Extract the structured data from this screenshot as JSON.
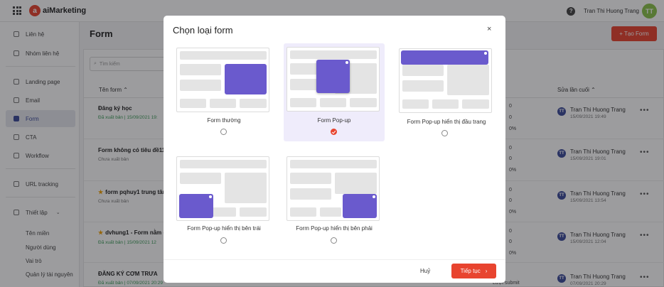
{
  "app": {
    "brand": "aiMarketing",
    "logo_letter": "a",
    "help": "?",
    "user_name": "Tran Thi Huong Trang",
    "user_initials": "TT"
  },
  "sidebar": {
    "items": [
      {
        "label": "Liên hệ"
      },
      {
        "label": "Nhóm liên hệ"
      },
      {
        "label": "Landing page"
      },
      {
        "label": "Email"
      },
      {
        "label": "Form"
      },
      {
        "label": "CTA"
      },
      {
        "label": "Workflow"
      },
      {
        "label": "URL tracking"
      },
      {
        "label": "Thiết lập"
      }
    ],
    "settings_chevron": "⌄",
    "sub_items": [
      {
        "label": "Tên miền"
      },
      {
        "label": "Người dùng"
      },
      {
        "label": "Vai trò"
      },
      {
        "label": "Quản lý tài nguyên"
      }
    ]
  },
  "main": {
    "title": "Form",
    "create_label": "+ Tạo Form",
    "search_placeholder": "Tìm kiếm",
    "columns": {
      "name": "Tên form ⌃",
      "last_edit": "Sửa lần cuối ⌃"
    },
    "rows": [
      {
        "name": "Đăng ký học",
        "status": "Đã xuất bản | 15/09/2021 19:",
        "v1": "0",
        "v2": "0",
        "v3": "0%",
        "editor": "Tran Thi Huong Trang",
        "date": "15/09/2021 19:49",
        "more": "•••"
      },
      {
        "name": "Form không có tiêu đề111",
        "status": "Chưa xuất bản",
        "v1": "0",
        "v2": "0",
        "v3": "0%",
        "editor": "Tran Thi Huong Trang",
        "date": "15/09/2021 19:01",
        "more": "•••"
      },
      {
        "name": "form pqhuy1 trung tâm",
        "status": "Chưa xuất bản",
        "v1": "0",
        "v2": "0",
        "v3": "0%",
        "editor": "Tran Thi Huong Trang",
        "date": "15/09/2021 13:54",
        "more": "•••"
      },
      {
        "name": "dvhung1 - Form nằm ở gi",
        "status": "Đã xuất bản | 15/09/2021 12",
        "v1": "0",
        "v2": "0",
        "v3": "0%",
        "editor": "Tran Thi Huong Trang",
        "date": "15/09/2021 12:04",
        "more": "•••"
      },
      {
        "name": "ĐĂNG KÝ CƠM TRƯA",
        "status": "Đã xuất bản | 07/09/2021 20:29",
        "v1": "Lượt submit",
        "v2": "",
        "v3": "",
        "editor": "Tran Thi Huong Trang",
        "date": "07/09/2021 20:29",
        "more": "•••"
      }
    ]
  },
  "modal": {
    "title": "Chọn loại form",
    "close": "×",
    "options": [
      {
        "label": "Form thường",
        "selected": false
      },
      {
        "label": "Form Pop-up",
        "selected": true
      },
      {
        "label": "Form Pop-up hiển thị đầu trang",
        "selected": false
      },
      {
        "label": "Form Pop-up hiển thị bên trái",
        "selected": false
      },
      {
        "label": "Form Pop-up hiển thị bên phải",
        "selected": false
      }
    ],
    "cancel_label": "Huỷ",
    "next_label": "Tiếp tục",
    "next_arrow": "›"
  },
  "colors": {
    "accent": "#e8442f",
    "popup": "#6a5acd",
    "selected_bg": "#efecfb",
    "active_nav": "#3c4a9a"
  }
}
